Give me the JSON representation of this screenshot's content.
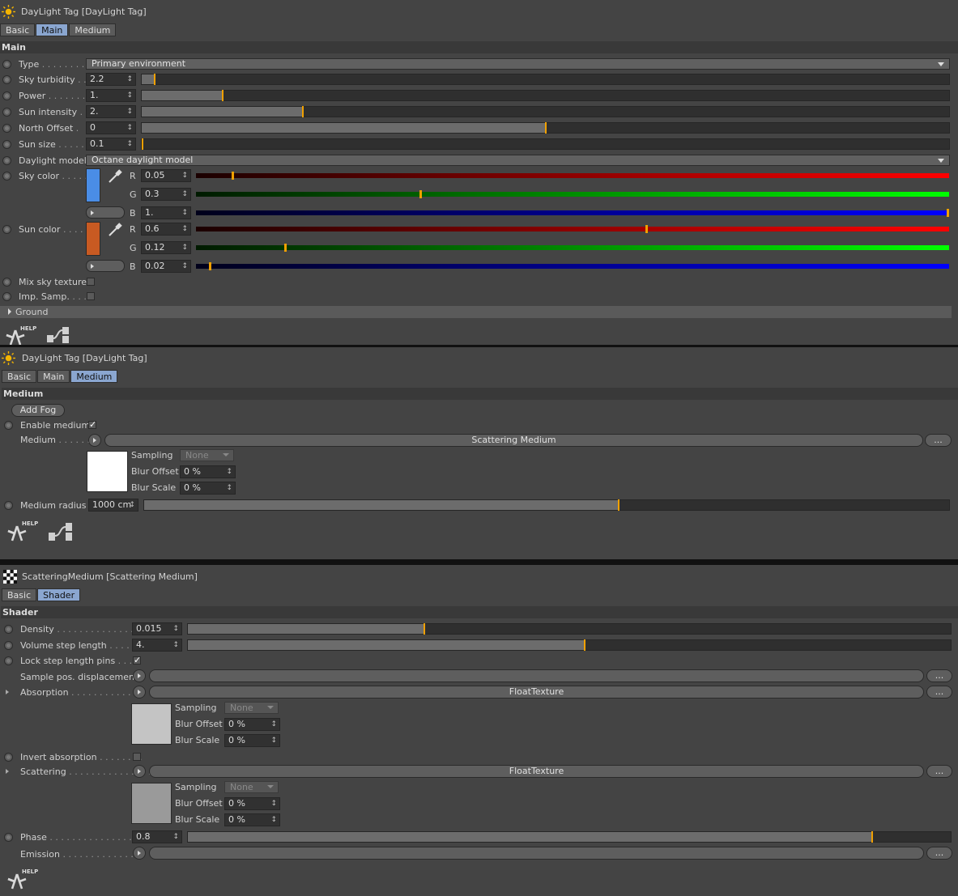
{
  "panel1": {
    "title": "DayLight Tag [DayLight Tag]",
    "tabs": [
      "Basic",
      "Main",
      "Medium"
    ],
    "active_tab": "Main",
    "section": "Main",
    "type_label": "Type",
    "type_value": "Primary environment",
    "sky_turbidity": {
      "label": "Sky turbidity",
      "value": "2.2",
      "fraction": 0.016
    },
    "power": {
      "label": "Power",
      "value": "1.",
      "fraction": 0.1
    },
    "sun_intensity": {
      "label": "Sun intensity",
      "value": "2.",
      "fraction": 0.2
    },
    "north_offset": {
      "label": "North Offset",
      "value": "0",
      "fraction": 0.5
    },
    "sun_size": {
      "label": "Sun size",
      "value": "0.1",
      "fraction": 0.001
    },
    "daylight_model_label": "Daylight model",
    "daylight_model_value": "Octane daylight model",
    "sky_color": {
      "label": "Sky color",
      "swatch": "#4a8de6",
      "r": "0.05",
      "g": "0.3",
      "b": "1.",
      "r_frac": 0.05,
      "g_frac": 0.3,
      "b_frac": 1.0
    },
    "sun_color": {
      "label": "Sun color",
      "swatch": "#c85a22",
      "r": "0.6",
      "g": "0.12",
      "b": "0.02",
      "r_frac": 0.6,
      "g_frac": 0.12,
      "b_frac": 0.02
    },
    "channel_r": "R",
    "channel_g": "G",
    "channel_b": "B",
    "mix_sky_texture": "Mix sky texture",
    "imp_samp": "Imp. Samp.",
    "ground": "Ground",
    "help": "HELP"
  },
  "panel2": {
    "title": "DayLight Tag [DayLight Tag]",
    "tabs": [
      "Basic",
      "Main",
      "Medium"
    ],
    "active_tab": "Medium",
    "section": "Medium",
    "add_fog": "Add Fog",
    "enable_medium": "Enable medium",
    "medium_label": "Medium",
    "medium_value": "Scattering Medium",
    "more": "...",
    "sampling_label": "Sampling",
    "sampling_value": "None",
    "blur_offset_label": "Blur Offset",
    "blur_offset_value": "0 %",
    "blur_scale_label": "Blur Scale",
    "blur_scale_value": "0 %",
    "medium_radius": {
      "label": "Medium radius",
      "value": "1000 cm",
      "fraction": 0.59
    },
    "help": "HELP"
  },
  "panel3": {
    "title": "ScatteringMedium [Scattering Medium]",
    "tabs": [
      "Basic",
      "Shader"
    ],
    "active_tab": "Shader",
    "section": "Shader",
    "density": {
      "label": "Density",
      "value": "0.015",
      "fraction": 0.31
    },
    "volume_step": {
      "label": "Volume step length",
      "value": "4.",
      "fraction": 0.52
    },
    "lock_step": "Lock step length pins",
    "sample_pos": "Sample pos. displacement",
    "absorption": "Absorption",
    "absorption_value": "FloatTexture",
    "invert_absorption": "Invert absorption",
    "scattering": "Scattering",
    "scattering_value": "FloatTexture",
    "phase": {
      "label": "Phase",
      "value": "0.8",
      "fraction": 0.897
    },
    "emission": "Emission",
    "more": "...",
    "sampling_label": "Sampling",
    "sampling_value": "None",
    "blur_offset_label": "Blur Offset",
    "blur_offset_value": "0 %",
    "blur_scale_label": "Blur Scale",
    "blur_scale_value": "0 %",
    "help": "HELP"
  }
}
